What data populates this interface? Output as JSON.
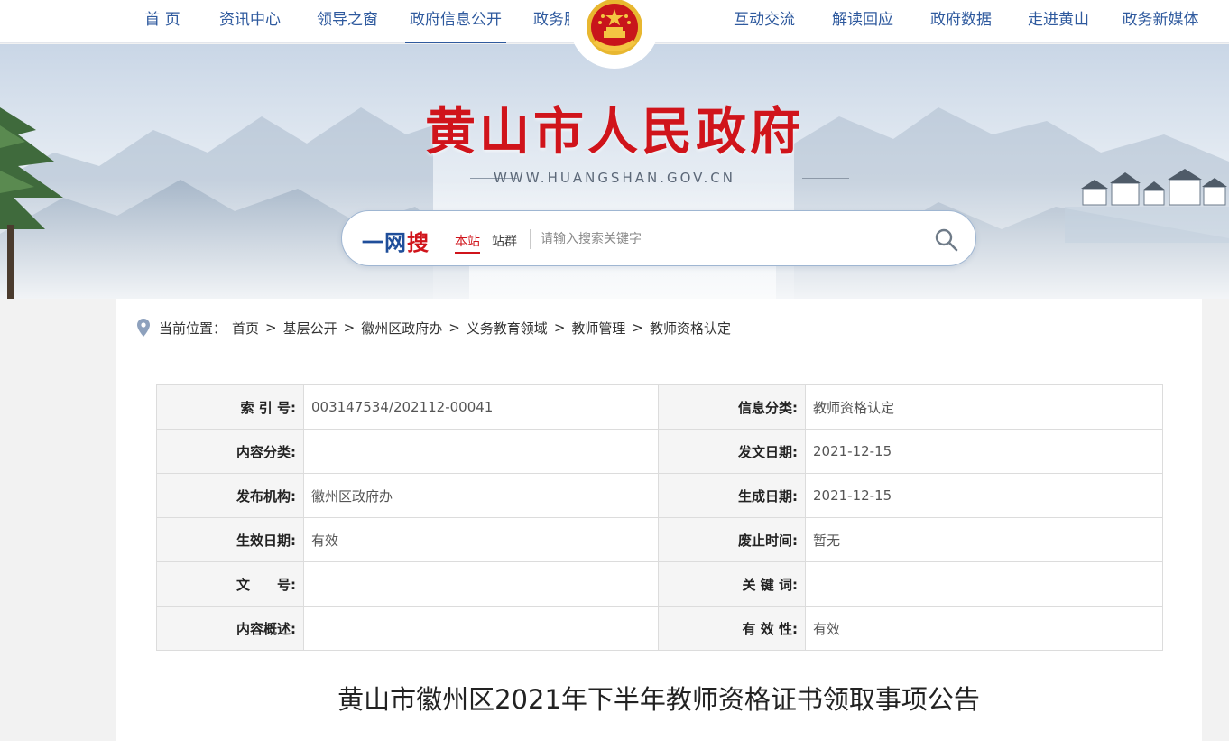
{
  "nav": {
    "left": [
      "首 页",
      "资讯中心",
      "领导之窗",
      "政府信息公开",
      "政务服务"
    ],
    "right": [
      "互动交流",
      "解读回应",
      "政府数据",
      "走进黄山",
      "政务新媒体"
    ],
    "active": "政府信息公开"
  },
  "banner": {
    "title": "黄山市人民政府",
    "url": "WWW.HUANGSHAN.GOV.CN"
  },
  "search": {
    "logo_main": "一网",
    "logo_hl": "搜",
    "scope_site": "本站",
    "scope_group": "站群",
    "placeholder": "请输入搜索关键字"
  },
  "breadcrumb": {
    "label": "当前位置：",
    "items": [
      "首页",
      "基层公开",
      "徽州区政府办",
      "义务教育领域",
      "教师管理",
      "教师资格认定"
    ],
    "sep": ">"
  },
  "meta": {
    "rows": [
      [
        {
          "k": "索 引 号:",
          "v": "003147534/202112-00041"
        },
        {
          "k": "信息分类:",
          "v": "教师资格认定"
        }
      ],
      [
        {
          "k": "内容分类:",
          "v": ""
        },
        {
          "k": "发文日期:",
          "v": "2021-12-15"
        }
      ],
      [
        {
          "k": "发布机构:",
          "v": "徽州区政府办"
        },
        {
          "k": "生成日期:",
          "v": "2021-12-15"
        }
      ],
      [
        {
          "k": "生效日期:",
          "v": "有效"
        },
        {
          "k": "废止时间:",
          "v": "暂无"
        }
      ],
      [
        {
          "k": "文　　号:",
          "v": ""
        },
        {
          "k": "关 键 词:",
          "v": ""
        }
      ],
      [
        {
          "k": "内容概述:",
          "v": ""
        },
        {
          "k": "有 效 性:",
          "v": "有效"
        }
      ]
    ]
  },
  "article": {
    "title": "黄山市徽州区2021年下半年教师资格证书领取事项公告"
  },
  "colors": {
    "nav_blue": "#2f5a9e",
    "title_red": "#d0141b",
    "logo_blue": "#1f4e9a"
  },
  "icons": {
    "emblem": "national-emblem-icon",
    "search": "magnifier-icon",
    "location": "map-pin-icon"
  }
}
